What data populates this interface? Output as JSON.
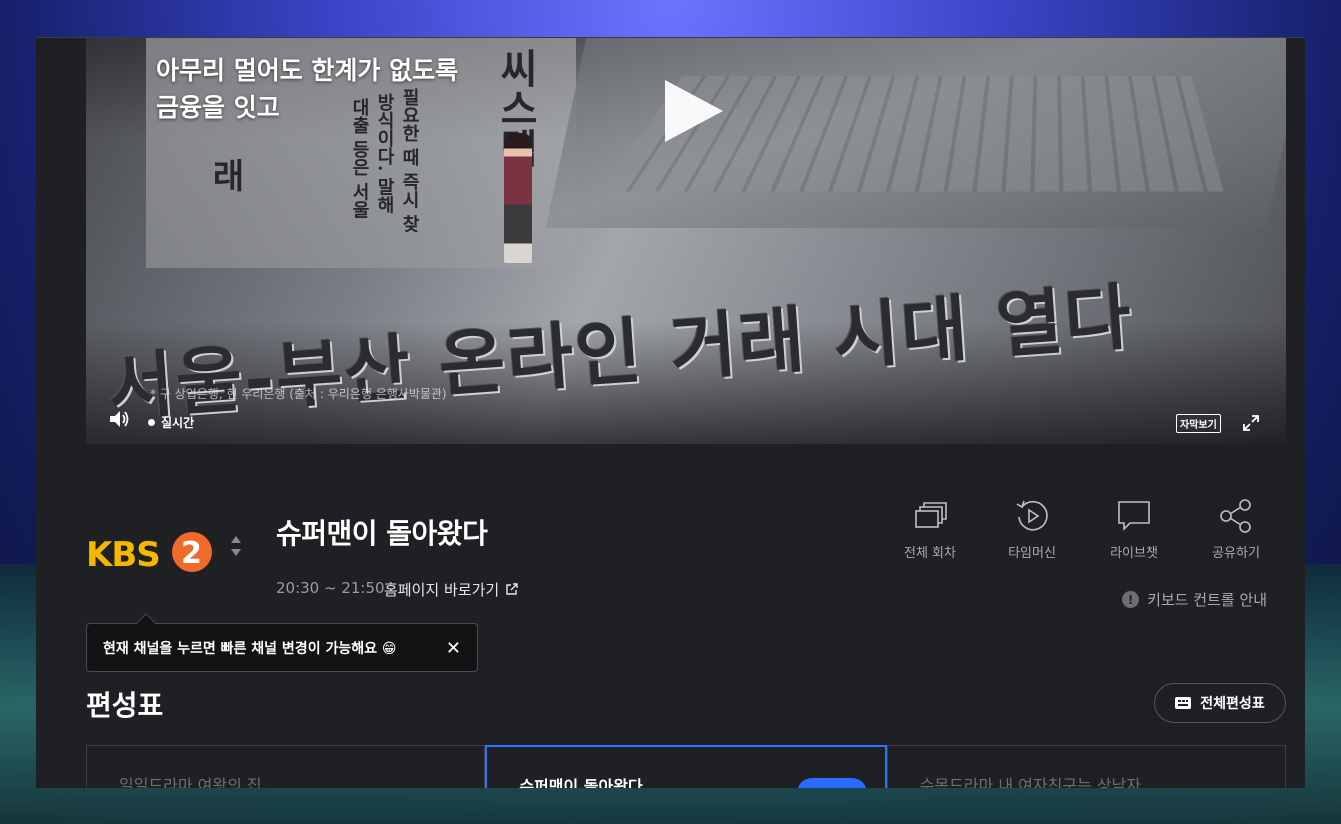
{
  "video": {
    "caption_line1": "아무리 멀어도 한계가 없도록",
    "caption_line2": "금융을 잇고",
    "headline": "서울-부산 온라인 거래 시대 열다",
    "vertical_col1": "씨스템",
    "vertical_col2": "필요한 때 즉시 찾",
    "vertical_col3": "방식이다. 말해",
    "vertical_col4": "대출 등은 서울",
    "vertical_col5": "래",
    "source_note": "* 구 상업은행, 현 우리은행 (출처 : 우리은행 은행사박물관)",
    "live_label": "실시간",
    "subtitle_label": "자막보기"
  },
  "channel": {
    "logo_text": "KBS",
    "logo_number": "2",
    "accent_color": "#f5b700",
    "number_color": "#f06a2a"
  },
  "program": {
    "title": "슈퍼맨이 돌아왔다",
    "time": "20:30 ~ 21:50",
    "homepage_label": "홈페이지 바로가기"
  },
  "actions": [
    {
      "label": "전체 회차",
      "icon": "episodes-icon"
    },
    {
      "label": "타임머신",
      "icon": "timemachine-icon"
    },
    {
      "label": "라이브챗",
      "icon": "chat-icon"
    },
    {
      "label": "공유하기",
      "icon": "share-icon"
    }
  ],
  "keyboard_guide": "키보드 컨트롤 안내",
  "tooltip": {
    "text": "현재 채널을 누르면 빠른 채널 변경이 가능해요 😁",
    "close": "✕"
  },
  "schedule": {
    "title": "편성표",
    "full_button": "전체편성표",
    "cards": [
      {
        "title": "일일드라마 여왕의 집"
      },
      {
        "title": "슈퍼맨이 돌아왔다"
      },
      {
        "title": "수목드라마 내 여자친구는 상남자"
      }
    ]
  }
}
